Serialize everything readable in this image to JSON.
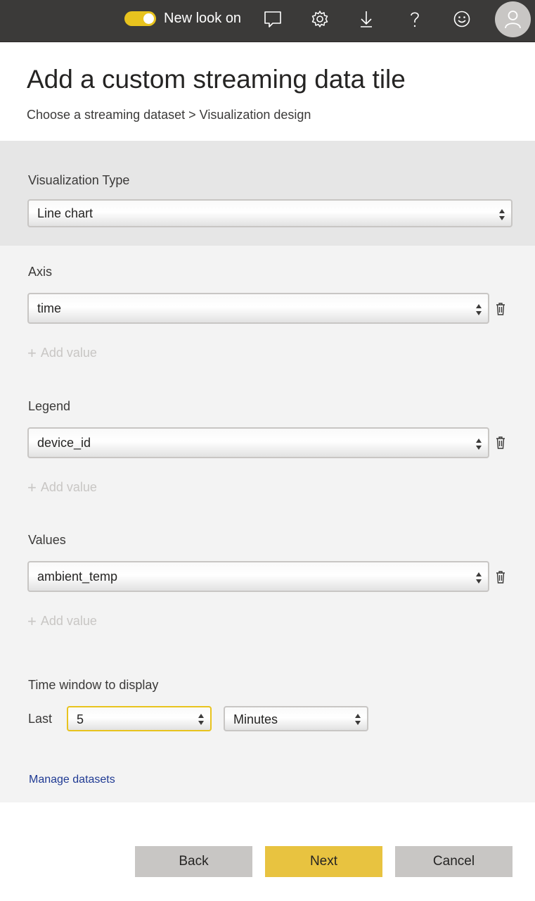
{
  "topbar": {
    "toggle_label": "New look on",
    "toggle_state": "on",
    "icons": [
      "comment-icon",
      "gear-icon",
      "download-icon",
      "help-icon",
      "smiley-icon",
      "user-icon"
    ],
    "accent_color": "#e8c31e"
  },
  "header": {
    "title": "Add a custom streaming data tile",
    "breadcrumb": "Choose a streaming dataset > Visualization design"
  },
  "visualization": {
    "label": "Visualization Type",
    "value": "Line chart"
  },
  "axis": {
    "label": "Axis",
    "value": "time",
    "add_label": "Add value"
  },
  "legend": {
    "label": "Legend",
    "value": "device_id",
    "add_label": "Add value"
  },
  "values": {
    "label": "Values",
    "value": "ambient_temp",
    "add_label": "Add value"
  },
  "time_window": {
    "label": "Time window to display",
    "last_label": "Last",
    "amount": "5",
    "unit": "Minutes"
  },
  "manage_link": "Manage datasets",
  "buttons": {
    "back": "Back",
    "next": "Next",
    "cancel": "Cancel"
  }
}
